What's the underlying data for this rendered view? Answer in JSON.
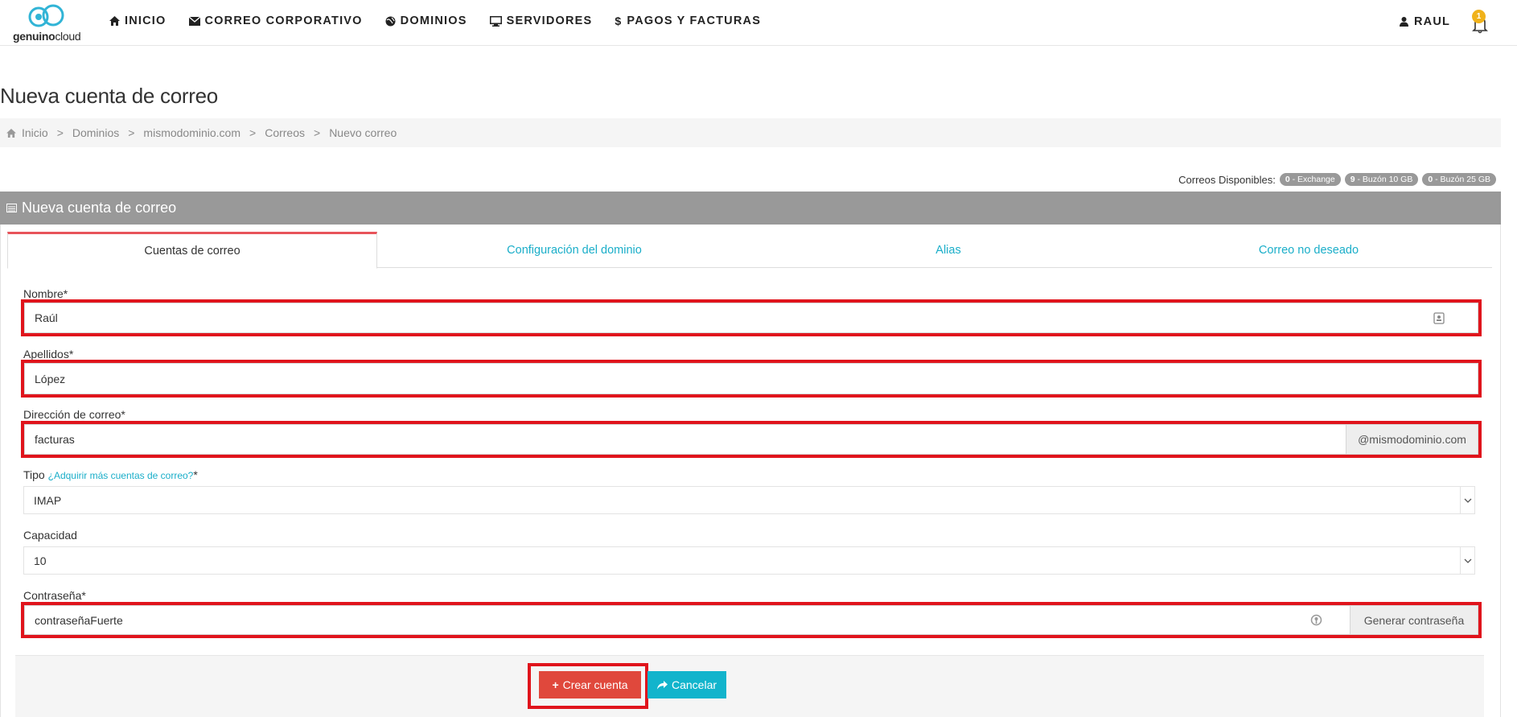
{
  "header": {
    "logo": {
      "brand_bold": "genuino",
      "brand_light": "cloud"
    },
    "nav": [
      {
        "label": "INICIO",
        "icon": "home-icon"
      },
      {
        "label": "CORREO CORPORATIVO",
        "icon": "envelope-icon"
      },
      {
        "label": "DOMINIOS",
        "icon": "globe-icon"
      },
      {
        "label": "SERVIDORES",
        "icon": "monitor-icon"
      },
      {
        "label": "PAGOS Y FACTURAS",
        "icon": "dollar-icon"
      }
    ],
    "user": {
      "name": "RAUL",
      "icon": "user-icon"
    },
    "notifications": {
      "count": "1",
      "icon": "bell-icon"
    }
  },
  "page": {
    "title": "Nueva cuenta de correo"
  },
  "breadcrumb": [
    "Inicio",
    "Dominios",
    "mismodominio.com",
    "Correos",
    "Nuevo correo"
  ],
  "available": {
    "label": "Correos Disponibles:",
    "pills": [
      {
        "count": "0",
        "text": "- Exchange"
      },
      {
        "count": "9",
        "text": "- Buzón 10 GB"
      },
      {
        "count": "0",
        "text": "- Buzón 25 GB"
      }
    ]
  },
  "panel": {
    "title": "Nueva cuenta de correo",
    "icon": "list-icon"
  },
  "tabs": [
    {
      "label": "Cuentas de correo",
      "active": true
    },
    {
      "label": "Configuración del dominio",
      "active": false
    },
    {
      "label": "Alias",
      "active": false
    },
    {
      "label": "Correo no deseado",
      "active": false
    }
  ],
  "form": {
    "nombre": {
      "label": "Nombre*",
      "value": "Raúl"
    },
    "apellidos": {
      "label": "Apellidos*",
      "value": "López"
    },
    "direccion": {
      "label": "Dirección de correo*",
      "value": "facturas",
      "suffix": "@mismodominio.com"
    },
    "tipo": {
      "label": "Tipo",
      "link": "¿Adquirir más cuentas de correo?",
      "required": "*",
      "value": "IMAP"
    },
    "capacidad": {
      "label": "Capacidad",
      "value": "10"
    },
    "contrasena": {
      "label": "Contraseña*",
      "value": "contraseñaFuerte",
      "generate_label": "Generar contraseña"
    }
  },
  "actions": {
    "create_label": "Crear cuenta",
    "cancel_label": "Cancelar"
  },
  "colors": {
    "accent": "#1aaec9",
    "create": "#e0483c",
    "cancel": "#12b4cc",
    "highlight": "#e0141c",
    "panel_header": "#999999",
    "badge": "#f0b21a"
  }
}
